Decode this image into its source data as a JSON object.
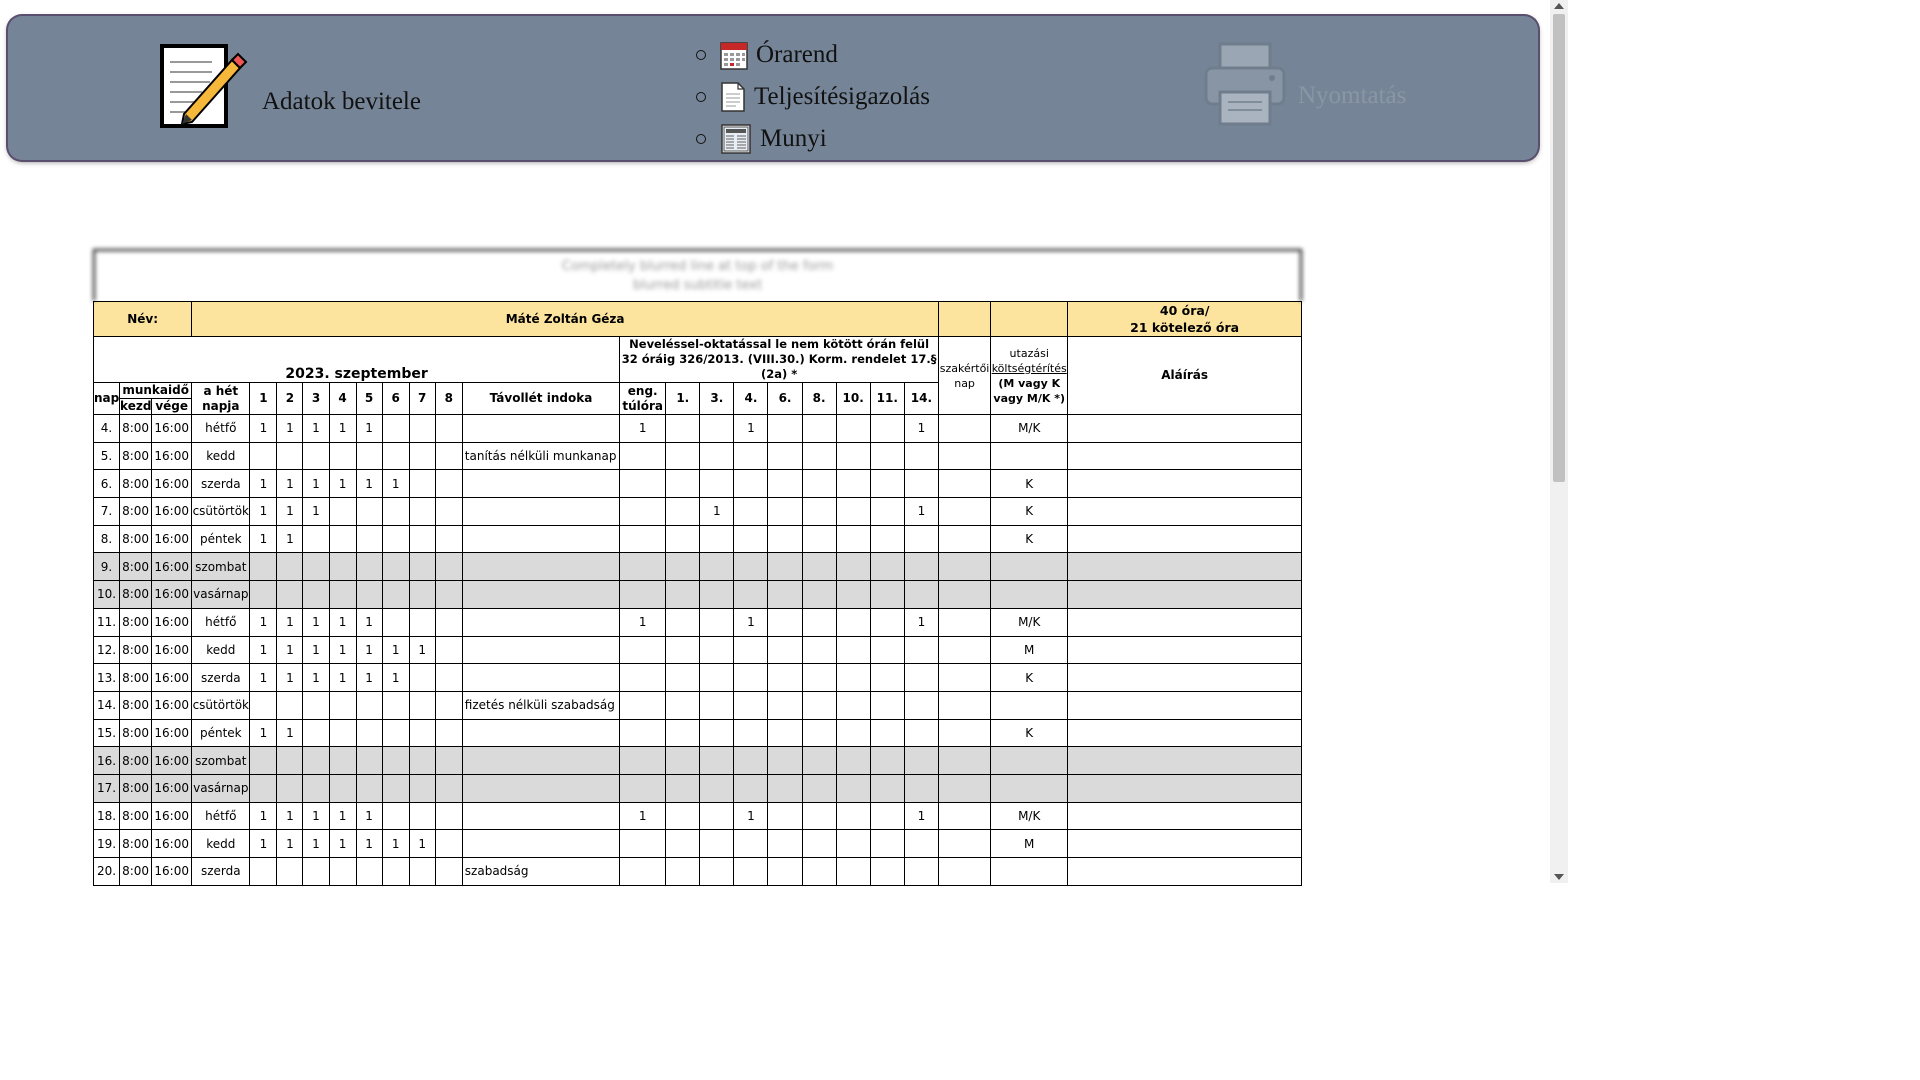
{
  "header": {
    "adatok_label": "Adatok bevitele",
    "menu": [
      {
        "label": "Órarend",
        "icon": "calendar-icon"
      },
      {
        "label": "Teljesítésigazolás",
        "icon": "document-icon"
      },
      {
        "label": "Munyi",
        "icon": "newspaper-icon"
      }
    ],
    "print_label": "Nyomtatás"
  },
  "sheet": {
    "top_line1": "Completely blurred line at top of the form",
    "top_line2": "blurred subtitle text",
    "name_label": "Név:",
    "name_value": "Máté Zoltán Géza",
    "hours_line1": "40 óra/",
    "hours_line2": "21 kötelező óra",
    "month": "2023. szeptember",
    "overtime_header": "Neveléssel-oktatással le nem kötött órán felül 32 óráig 326/2013. (VIII.30.) Korm. rendelet 17.§ (2a) *",
    "expert_day": "szakértői nap",
    "travel_1": "utazási",
    "travel_2": "költségtérítés",
    "travel_3": "(M vagy K vagy M/K *)",
    "signature": "Aláírás",
    "col_nap": "nap",
    "col_munkaido": "munkaidő",
    "col_kezd": "kezd.",
    "col_vege": "vége",
    "col_het_napja": "a hét napja",
    "hour_cols": [
      "1",
      "2",
      "3",
      "4",
      "5",
      "6",
      "7",
      "8"
    ],
    "col_absence": "Távollét indoka",
    "col_eng": "eng. túlóra",
    "ot_cols": [
      "1.",
      "3.",
      "4.",
      "6.",
      "8.",
      "10.",
      "11.",
      "14."
    ],
    "rows": [
      {
        "nap": "4.",
        "kezd": "8:00",
        "vege": "16:00",
        "day": "hétfő",
        "h": [
          "1",
          "1",
          "1",
          "1",
          "1",
          "",
          "",
          ""
        ],
        "absence": "",
        "eng": "1",
        "ot": [
          "",
          "",
          "1",
          "",
          "",
          "",
          "",
          "1"
        ],
        "travel": "M/K",
        "weekend": false
      },
      {
        "nap": "5.",
        "kezd": "8:00",
        "vege": "16:00",
        "day": "kedd",
        "h": [
          "",
          "",
          "",
          "",
          "",
          "",
          "",
          ""
        ],
        "absence": "tanítás nélküli munkanap",
        "eng": "",
        "ot": [
          "",
          "",
          "",
          "",
          "",
          "",
          "",
          ""
        ],
        "travel": "",
        "weekend": false
      },
      {
        "nap": "6.",
        "kezd": "8:00",
        "vege": "16:00",
        "day": "szerda",
        "h": [
          "1",
          "1",
          "1",
          "1",
          "1",
          "1",
          "",
          ""
        ],
        "absence": "",
        "eng": "",
        "ot": [
          "",
          "",
          "",
          "",
          "",
          "",
          "",
          ""
        ],
        "travel": "K",
        "weekend": false
      },
      {
        "nap": "7.",
        "kezd": "8:00",
        "vege": "16:00",
        "day": "csütörtök",
        "h": [
          "1",
          "1",
          "1",
          "",
          "",
          "",
          "",
          ""
        ],
        "absence": "",
        "eng": "",
        "ot": [
          "",
          "1",
          "",
          "",
          "",
          "",
          "",
          "1"
        ],
        "travel": "K",
        "weekend": false
      },
      {
        "nap": "8.",
        "kezd": "8:00",
        "vege": "16:00",
        "day": "péntek",
        "h": [
          "1",
          "1",
          "",
          "",
          "",
          "",
          "",
          ""
        ],
        "absence": "",
        "eng": "",
        "ot": [
          "",
          "",
          "",
          "",
          "",
          "",
          "",
          ""
        ],
        "travel": "K",
        "weekend": false
      },
      {
        "nap": "9.",
        "kezd": "8:00",
        "vege": "16:00",
        "day": "szombat",
        "h": [
          "",
          "",
          "",
          "",
          "",
          "",
          "",
          ""
        ],
        "absence": "",
        "eng": "",
        "ot": [
          "",
          "",
          "",
          "",
          "",
          "",
          "",
          ""
        ],
        "travel": "",
        "weekend": true
      },
      {
        "nap": "10.",
        "kezd": "8:00",
        "vege": "16:00",
        "day": "vasárnap",
        "h": [
          "",
          "",
          "",
          "",
          "",
          "",
          "",
          ""
        ],
        "absence": "",
        "eng": "",
        "ot": [
          "",
          "",
          "",
          "",
          "",
          "",
          "",
          ""
        ],
        "travel": "",
        "weekend": true
      },
      {
        "nap": "11.",
        "kezd": "8:00",
        "vege": "16:00",
        "day": "hétfő",
        "h": [
          "1",
          "1",
          "1",
          "1",
          "1",
          "",
          "",
          ""
        ],
        "absence": "",
        "eng": "1",
        "ot": [
          "",
          "",
          "1",
          "",
          "",
          "",
          "",
          "1"
        ],
        "travel": "M/K",
        "weekend": false
      },
      {
        "nap": "12.",
        "kezd": "8:00",
        "vege": "16:00",
        "day": "kedd",
        "h": [
          "1",
          "1",
          "1",
          "1",
          "1",
          "1",
          "1",
          ""
        ],
        "absence": "",
        "eng": "",
        "ot": [
          "",
          "",
          "",
          "",
          "",
          "",
          "",
          ""
        ],
        "travel": "M",
        "weekend": false
      },
      {
        "nap": "13.",
        "kezd": "8:00",
        "vege": "16:00",
        "day": "szerda",
        "h": [
          "1",
          "1",
          "1",
          "1",
          "1",
          "1",
          "",
          ""
        ],
        "absence": "",
        "eng": "",
        "ot": [
          "",
          "",
          "",
          "",
          "",
          "",
          "",
          ""
        ],
        "travel": "K",
        "weekend": false
      },
      {
        "nap": "14.",
        "kezd": "8:00",
        "vege": "16:00",
        "day": "csütörtök",
        "h": [
          "",
          "",
          "",
          "",
          "",
          "",
          "",
          ""
        ],
        "absence": "fizetés nélküli szabadság",
        "eng": "",
        "ot": [
          "",
          "",
          "",
          "",
          "",
          "",
          "",
          ""
        ],
        "travel": "",
        "weekend": false
      },
      {
        "nap": "15.",
        "kezd": "8:00",
        "vege": "16:00",
        "day": "péntek",
        "h": [
          "1",
          "1",
          "",
          "",
          "",
          "",
          "",
          ""
        ],
        "absence": "",
        "eng": "",
        "ot": [
          "",
          "",
          "",
          "",
          "",
          "",
          "",
          ""
        ],
        "travel": "K",
        "weekend": false
      },
      {
        "nap": "16.",
        "kezd": "8:00",
        "vege": "16:00",
        "day": "szombat",
        "h": [
          "",
          "",
          "",
          "",
          "",
          "",
          "",
          ""
        ],
        "absence": "",
        "eng": "",
        "ot": [
          "",
          "",
          "",
          "",
          "",
          "",
          "",
          ""
        ],
        "travel": "",
        "weekend": true
      },
      {
        "nap": "17.",
        "kezd": "8:00",
        "vege": "16:00",
        "day": "vasárnap",
        "h": [
          "",
          "",
          "",
          "",
          "",
          "",
          "",
          ""
        ],
        "absence": "",
        "eng": "",
        "ot": [
          "",
          "",
          "",
          "",
          "",
          "",
          "",
          ""
        ],
        "travel": "",
        "weekend": true
      },
      {
        "nap": "18.",
        "kezd": "8:00",
        "vege": "16:00",
        "day": "hétfő",
        "h": [
          "1",
          "1",
          "1",
          "1",
          "1",
          "",
          "",
          ""
        ],
        "absence": "",
        "eng": "1",
        "ot": [
          "",
          "",
          "1",
          "",
          "",
          "",
          "",
          "1"
        ],
        "travel": "M/K",
        "weekend": false
      },
      {
        "nap": "19.",
        "kezd": "8:00",
        "vege": "16:00",
        "day": "kedd",
        "h": [
          "1",
          "1",
          "1",
          "1",
          "1",
          "1",
          "1",
          ""
        ],
        "absence": "",
        "eng": "",
        "ot": [
          "",
          "",
          "",
          "",
          "",
          "",
          "",
          ""
        ],
        "travel": "M",
        "weekend": false
      },
      {
        "nap": "20.",
        "kezd": "8:00",
        "vege": "16:00",
        "day": "szerda",
        "h": [
          "",
          "",
          "",
          "",
          "",
          "",
          "",
          ""
        ],
        "absence": "szabadság",
        "eng": "",
        "ot": [
          "",
          "",
          "",
          "",
          "",
          "",
          "",
          ""
        ],
        "travel": "",
        "weekend": false
      }
    ]
  }
}
